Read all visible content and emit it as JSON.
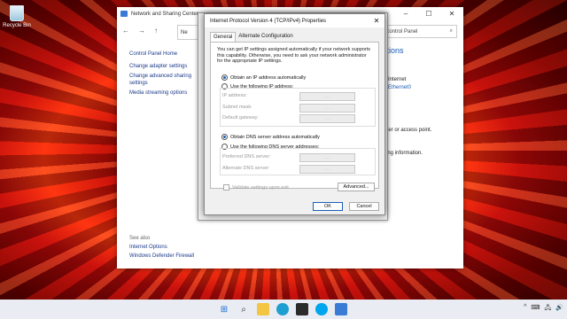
{
  "desktop": {
    "recycle_bin_label": "Recycle Bin"
  },
  "control_panel": {
    "title": "Network and Sharing Center",
    "address_fragment": "Ne",
    "search_placeholder": "ch Control Panel",
    "nav": {
      "back": "←",
      "forward": "→",
      "up": "↑"
    },
    "window_controls": {
      "minimize": "–",
      "maximize": "☐",
      "close": "✕"
    },
    "left_links": {
      "home": "Control Panel Home",
      "items": [
        "Change adapter settings",
        "Change advanced sharing settings",
        "Media streaming options"
      ]
    },
    "see_also": {
      "header": "See also",
      "links": [
        "Internet Options",
        "Windows Defender Firewall"
      ]
    },
    "right": {
      "section_title": "ctions",
      "internet_label": "Internet",
      "ethernet_link": "Ethernet0",
      "router_text": "outer or access point.",
      "info_text": "ing information."
    }
  },
  "dialog": {
    "title": "Internet Protocol Version 4 (TCP/IPv4) Properties",
    "close": "✕",
    "tabs": [
      {
        "label": "General"
      },
      {
        "label": "Alternate Configuration"
      }
    ],
    "description": "You can get IP settings assigned automatically if your network supports this capability. Otherwise, you need to ask your network administrator for the appropriate IP settings.",
    "ip": {
      "auto_label": "Obtain an IP address automatically",
      "manual_label": "Use the following IP address:",
      "ip_address_label": "IP address:",
      "subnet_label": "Subnet mask:",
      "gateway_label": "Default gateway:"
    },
    "dns": {
      "auto_label": "Obtain DNS server address automatically",
      "manual_label": "Use the following DNS server addresses:",
      "preferred_label": "Preferred DNS server:",
      "alternate_label": "Alternate DNS server:"
    },
    "ip_dots": ". . .",
    "validate_label": "Validate settings upon exit",
    "advanced_button": "Advanced...",
    "ok_button": "OK",
    "cancel_button": "Cancel"
  },
  "taskbar": {
    "icons": [
      "windows-start-icon",
      "search-icon",
      "file-explorer-icon",
      "edge-icon",
      "store-icon",
      "skype-icon",
      "control-panel-icon"
    ],
    "tray": [
      "^",
      "⌨",
      "🖧",
      "🔊"
    ]
  }
}
